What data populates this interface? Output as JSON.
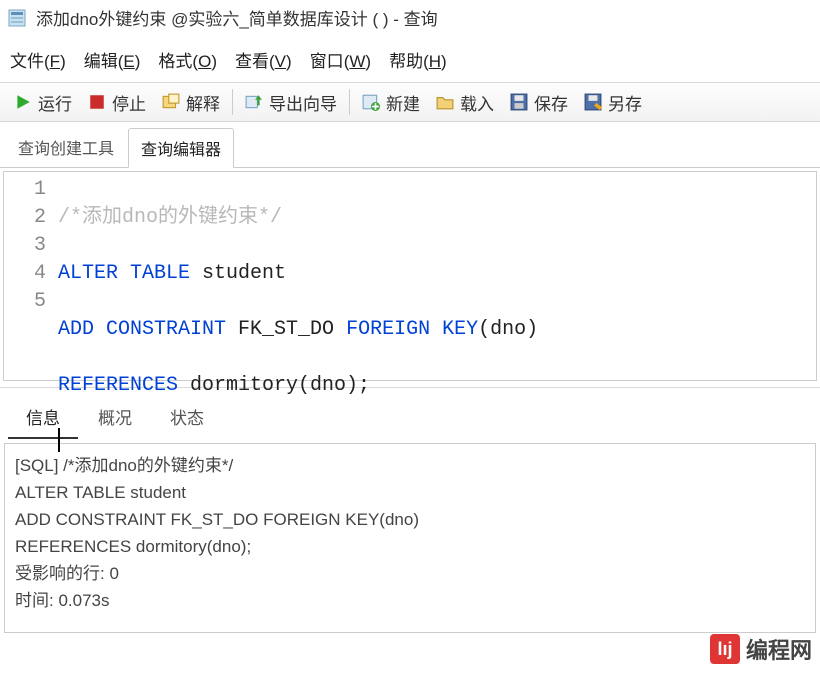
{
  "window": {
    "title": "添加dno外键约束 @实验六_简单数据库设计 (         ) - 查询"
  },
  "menu": {
    "file": "文件",
    "file_u": "F",
    "edit": "编辑",
    "edit_u": "E",
    "format": "格式",
    "format_u": "O",
    "view": "查看",
    "view_u": "V",
    "window": "窗口",
    "window_u": "W",
    "help": "帮助",
    "help_u": "H"
  },
  "toolbar": {
    "run": "运行",
    "stop": "停止",
    "explain": "解释",
    "export_wizard": "导出向导",
    "new": "新建",
    "load": "载入",
    "save": "保存",
    "save_as": "另存"
  },
  "tabs": {
    "builder": "查询创建工具",
    "editor": "查询编辑器"
  },
  "code": {
    "line_numbers": [
      "1",
      "2",
      "3",
      "4",
      "5"
    ],
    "l1_comment": "/*添加dno的外键约束*/",
    "l2_kw": "ALTER TABLE ",
    "l2_rest": "student",
    "l3_kw1": "ADD CONSTRAINT ",
    "l3_id": "FK_ST_DO ",
    "l3_kw2": "FOREIGN KEY",
    "l3_rest": "(dno)",
    "l4_kw": "REFERENCES ",
    "l4_rest": "dormitory(dno);"
  },
  "bottom_tabs": {
    "info": "信息",
    "profile": "概况",
    "status": "状态"
  },
  "messages": {
    "l1": "[SQL] /*添加dno的外键约束*/",
    "l2": "ALTER TABLE student",
    "l3": "ADD CONSTRAINT FK_ST_DO FOREIGN KEY(dno)",
    "l4": "REFERENCES dormitory(dno);",
    "l5": "受影响的行: 0",
    "l6": "时间: 0.073s"
  },
  "watermark": {
    "logo_text": "lıj",
    "text": "编程网"
  }
}
